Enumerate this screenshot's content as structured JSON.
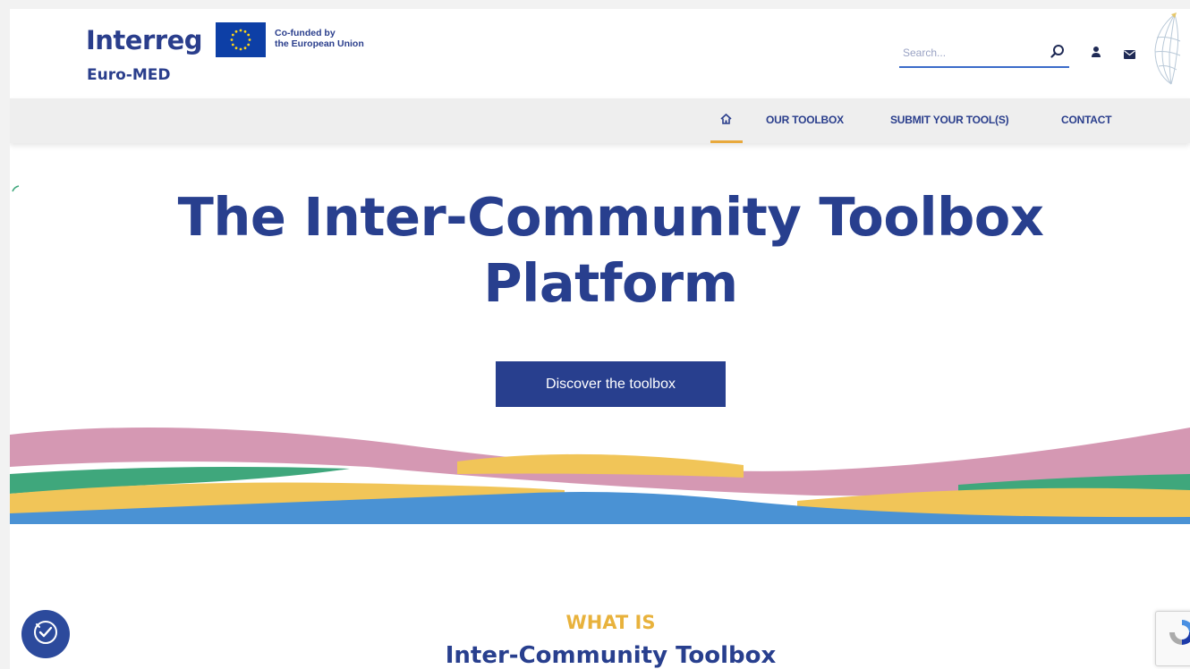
{
  "header": {
    "logo_word": "Interreg",
    "logo_sub": "Euro-MED",
    "eu_line1": "Co-funded by",
    "eu_line2": "the European Union",
    "search_placeholder": "Search..."
  },
  "nav": {
    "items": [
      {
        "label": "OUR TOOLBOX"
      },
      {
        "label": "SUBMIT YOUR TOOL(S)"
      },
      {
        "label": "CONTACT"
      }
    ],
    "active": "home"
  },
  "hero": {
    "title_line1": "The Inter-Community Toolbox",
    "title_line2": "Platform",
    "cta_label": "Discover the toolbox"
  },
  "section": {
    "kicker": "WHAT IS",
    "title": "Inter-Community Toolbox"
  },
  "colors": {
    "brand_blue": "#283f8e",
    "accent_yellow": "#e8b23c",
    "wave_pink": "#d598b3",
    "wave_green": "#3fa77c",
    "wave_yellow": "#f1c558",
    "wave_blue": "#4a92d4"
  },
  "icons": {
    "search": "search-icon",
    "user": "user-icon",
    "mail": "mail-icon",
    "home": "home-icon",
    "cookie": "cookie-settings-icon",
    "recaptcha": "recaptcha-icon"
  }
}
